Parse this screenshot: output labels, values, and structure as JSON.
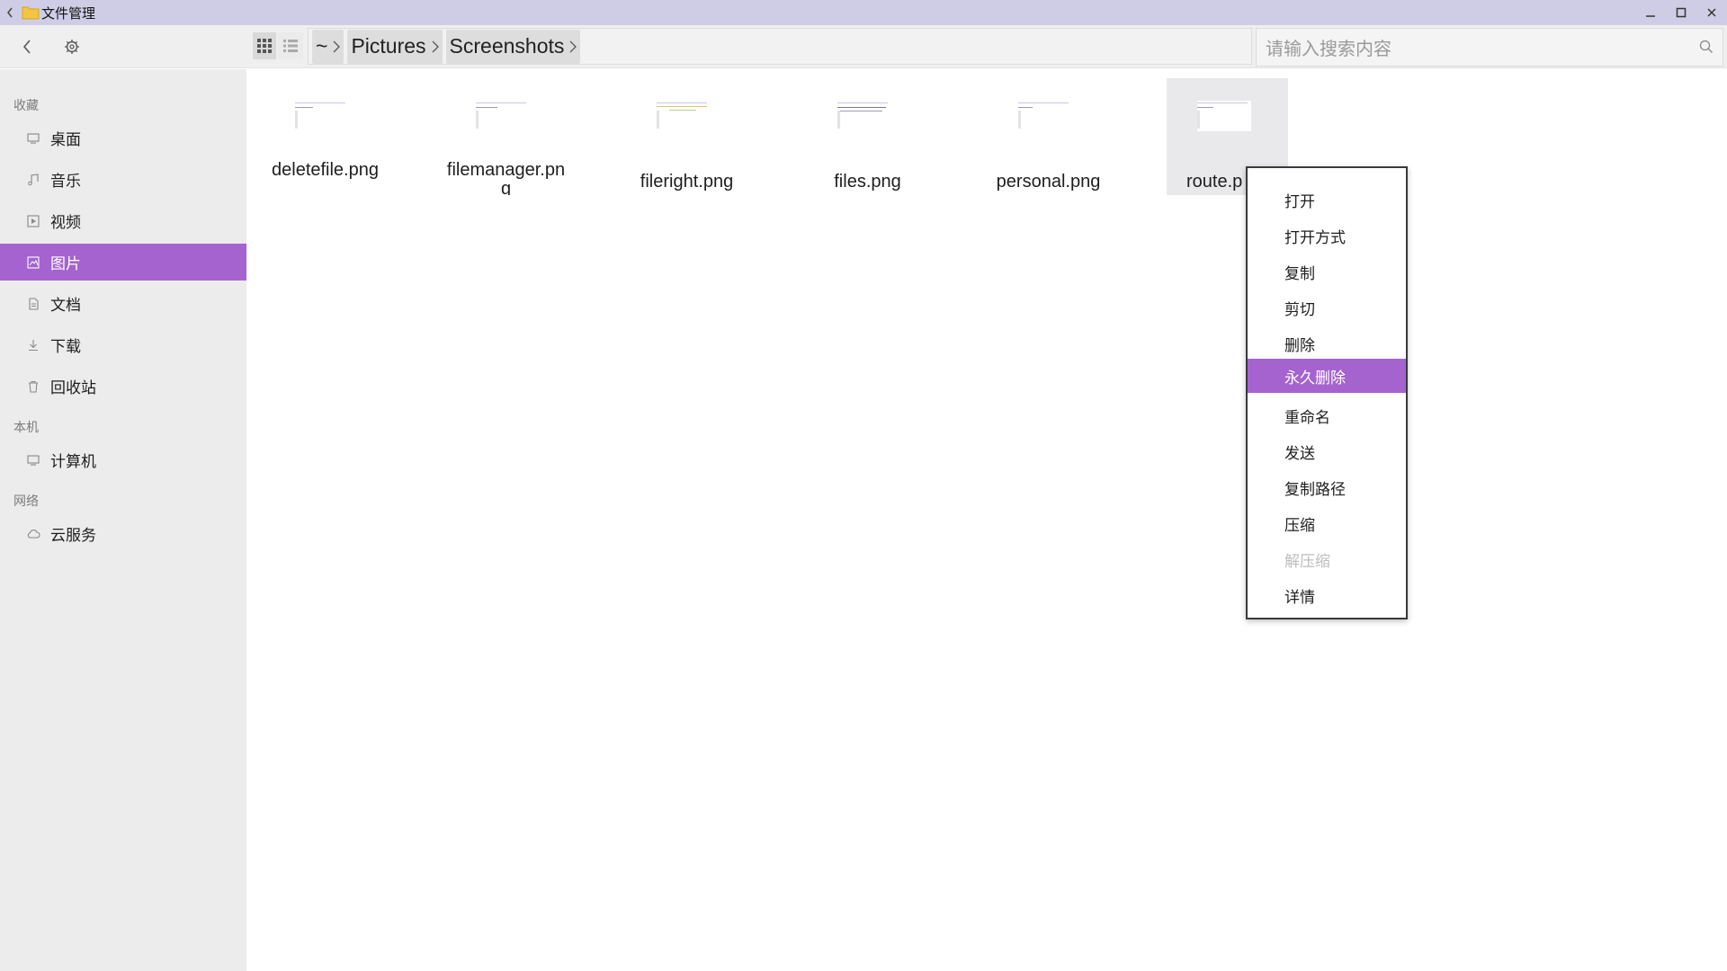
{
  "window": {
    "title": "文件管理"
  },
  "toolbar": {
    "breadcrumbs": [
      "~",
      "Pictures",
      "Screenshots"
    ],
    "search_placeholder": "请输入搜索内容"
  },
  "sidebar": {
    "sections": [
      {
        "header": "收藏"
      },
      {
        "header": "本机"
      },
      {
        "header": "网络"
      }
    ],
    "items": [
      {
        "label": "桌面",
        "icon": "desktop-icon"
      },
      {
        "label": "音乐",
        "icon": "music-icon"
      },
      {
        "label": "视频",
        "icon": "video-icon"
      },
      {
        "label": "图片",
        "icon": "picture-icon",
        "active": true
      },
      {
        "label": "文档",
        "icon": "document-icon"
      },
      {
        "label": "下载",
        "icon": "download-icon"
      },
      {
        "label": "回收站",
        "icon": "trash-icon"
      },
      {
        "label": "计算机",
        "icon": "computer-icon"
      },
      {
        "label": "云服务",
        "icon": "cloud-icon"
      }
    ]
  },
  "files": [
    {
      "name": "deletefile.png"
    },
    {
      "name": "filemanager.png"
    },
    {
      "name": "fileright.png"
    },
    {
      "name": "files.png"
    },
    {
      "name": "personal.png"
    },
    {
      "name": "route.png",
      "visible_name": "route.p",
      "hovered": true
    }
  ],
  "context_menu": {
    "items": [
      {
        "label": "打开"
      },
      {
        "label": "打开方式"
      },
      {
        "label": "复制"
      },
      {
        "label": "剪切"
      },
      {
        "label": "删除"
      },
      {
        "label": "永久删除",
        "highlighted": true
      },
      {
        "label": "重命名"
      },
      {
        "label": "发送"
      },
      {
        "label": "复制路径"
      },
      {
        "label": "压缩"
      },
      {
        "label": "解压缩",
        "disabled": true
      },
      {
        "label": "详情"
      }
    ]
  },
  "colors": {
    "accent": "#a463cf",
    "titlebar": "#cfcde6",
    "sidebar": "#ececec"
  }
}
